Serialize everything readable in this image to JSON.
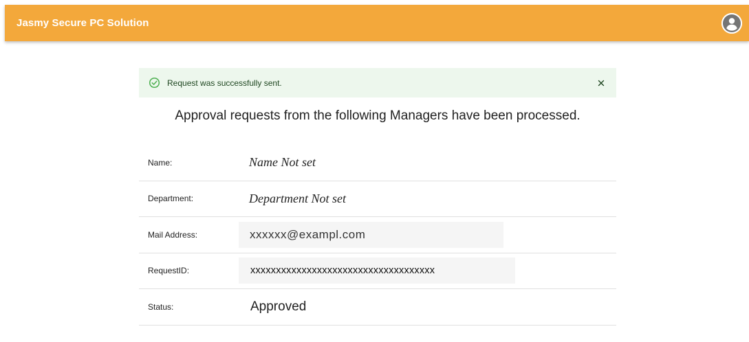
{
  "appbar": {
    "title": "Jasmy Secure PC Solution",
    "color": "#f3a83b",
    "account_icon": "account-circle-icon"
  },
  "alert": {
    "icon": "check-circle-icon",
    "message": "Request was successfully sent.",
    "close_icon": "close-icon",
    "background": "#edf7ed"
  },
  "heading": "Approval requests from the following Managers have been processed.",
  "details": {
    "name": {
      "label": "Name:",
      "value": "Name Not set"
    },
    "department": {
      "label": "Department:",
      "value": "Department Not set"
    },
    "mail": {
      "label": "Mail Address:",
      "value": "xxxxxx@exampl.com"
    },
    "request_id": {
      "label": "RequestID:",
      "value": "xxxxxxxxxxxxxxxxxxxxxxxxxxxxxxxxxxxx"
    },
    "status": {
      "label": "Status:",
      "value": "Approved"
    }
  }
}
